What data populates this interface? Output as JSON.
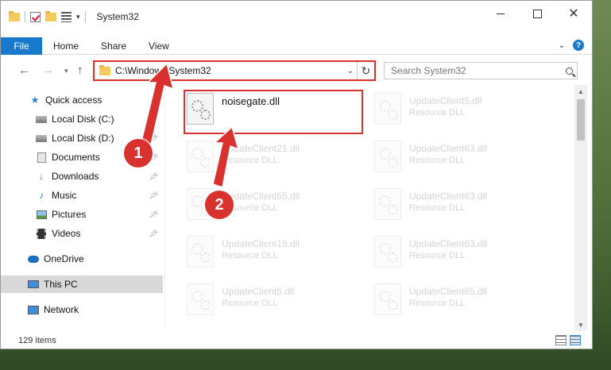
{
  "window": {
    "title": "System32"
  },
  "ribbon": {
    "file": "File",
    "home": "Home",
    "share": "Share",
    "view": "View"
  },
  "address": {
    "path": "C:\\Windows\\System32"
  },
  "search": {
    "placeholder": "Search System32"
  },
  "sidebar": {
    "items": [
      {
        "label": "Quick access"
      },
      {
        "label": "Local Disk (C:)"
      },
      {
        "label": "Local Disk (D:)"
      },
      {
        "label": "Documents"
      },
      {
        "label": "Downloads"
      },
      {
        "label": "Music"
      },
      {
        "label": "Pictures"
      },
      {
        "label": "Videos"
      },
      {
        "label": "OneDrive"
      },
      {
        "label": "This PC"
      },
      {
        "label": "Network"
      }
    ]
  },
  "files": [
    {
      "name": "noisegate.dll",
      "type": ""
    },
    {
      "name": "UpdateClient5.dll",
      "type": "Resource DLL"
    },
    {
      "name": "UpdateClient21.dll",
      "type": "Resource DLL"
    },
    {
      "name": "UpdateClient63.dll",
      "type": "Resource DLL"
    },
    {
      "name": "UpdateClient65.dll",
      "type": "Resource DLL"
    },
    {
      "name": "UpdateClient63.dll",
      "type": "Resource DLL"
    },
    {
      "name": "UpdateClient19.dll",
      "type": "Resource DLL"
    },
    {
      "name": "UpdateClient63.dll",
      "type": "Resource DLL"
    },
    {
      "name": "UpdateClient5.dll",
      "type": "Resource DLL"
    },
    {
      "name": "UpdateClient65.dll",
      "type": "Resource DLL"
    }
  ],
  "status": {
    "count": "129 items"
  },
  "annotations": {
    "step1": "1",
    "step2": "2",
    "color": "#d9312e"
  }
}
